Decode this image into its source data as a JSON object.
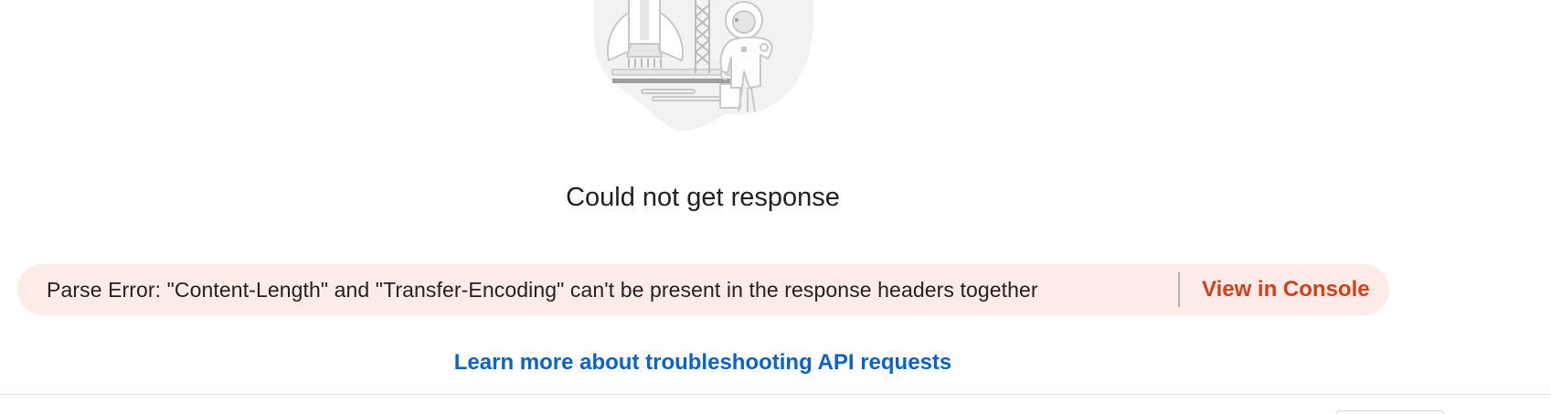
{
  "response_pane": {
    "illustration": {
      "icon": "rocket-astronaut-illustration",
      "colors": {
        "blob": "#f2f2f2",
        "stroke": "#c8c8c8",
        "fill": "#e6e6e6",
        "dark": "#9e9e9e"
      }
    },
    "title": "Could not get response",
    "error": {
      "message": "Parse Error: \"Content-Length\" and \"Transfer-Encoding\" can't be present in the response headers together",
      "action_label": "View in Console",
      "background_color": "#fdebe8",
      "action_color": "#d23f1b"
    },
    "learn_more_label": "Learn more about troubleshooting API requests",
    "link_color": "#0b62c9"
  }
}
